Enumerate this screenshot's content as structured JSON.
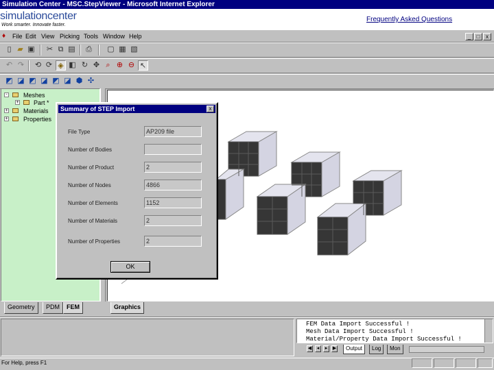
{
  "window": {
    "title": "Simulation Center - MSC.StepViewer - Microsoft Internet Explorer"
  },
  "banner": {
    "logo_text": "simulationcenter",
    "tagline": "Work smarter. Innovate faster.",
    "faq_link": "Frequently Asked Questions"
  },
  "menu": {
    "items": [
      "File",
      "Edit",
      "View",
      "Picking",
      "Tools",
      "Window",
      "Help"
    ],
    "window_controls": [
      "_",
      "□",
      "x"
    ]
  },
  "toolbar1": {
    "icons": [
      "new-icon",
      "open-icon",
      "save-icon",
      "cut-icon",
      "copy-icon",
      "paste-icon",
      "print-icon",
      "window-icon",
      "window2-icon",
      "window3-icon"
    ]
  },
  "toolbar2": {
    "icons": [
      "undo-icon",
      "redo-icon",
      "rotate-icon",
      "spin-icon",
      "shade-icon",
      "fit-icon",
      "rotate-view-icon",
      "pan-icon",
      "zoom-icon",
      "zoom-in-icon",
      "zoom-out-icon",
      "select-icon"
    ]
  },
  "toolbar3": {
    "icons": [
      "view-front-icon",
      "view-back-icon",
      "view-left-icon",
      "view-right-icon",
      "view-top-icon",
      "view-bottom-icon",
      "view-iso-icon",
      "view-axis-icon"
    ]
  },
  "tree": {
    "items": [
      {
        "label": "Meshes",
        "expander": "-",
        "level": 0
      },
      {
        "label": "Part *",
        "expander": "+",
        "level": 1
      },
      {
        "label": "Materials",
        "expander": "+",
        "level": 0
      },
      {
        "label": "Properties",
        "expander": "+",
        "level": 0
      }
    ]
  },
  "left_tabs": [
    "Geometry",
    "PDM",
    "FEM"
  ],
  "left_tabs_active": "FEM",
  "view_tabs": [
    "Graphics"
  ],
  "dialog": {
    "title": "Summary of STEP Import",
    "close": "x",
    "fields": [
      {
        "label": "File Type",
        "value": "AP209 file"
      },
      {
        "label": "Number of Bodies",
        "value": ""
      },
      {
        "label": "Number of Product",
        "value": "2"
      },
      {
        "label": "Number of Nodes",
        "value": "4866"
      },
      {
        "label": "Number of Elements",
        "value": "1152"
      },
      {
        "label": "Number of Materials",
        "value": "2"
      },
      {
        "label": "Number of Properties",
        "value": "2"
      }
    ],
    "ok_label": "OK"
  },
  "output": {
    "lines": [
      "FEM Data Import Successful !",
      "Mesh Data Import Successful !",
      "Material/Property Data Import Successful !"
    ],
    "tabs": [
      "Output",
      "Log",
      "Mon"
    ],
    "active_tab": "Output"
  },
  "status": {
    "text": "For Help, press F1"
  },
  "colors": {
    "titlebar": "#000080",
    "tree_bg": "#c8f0c8",
    "box_face": "#d6d6e4",
    "box_shade": "#333333"
  }
}
